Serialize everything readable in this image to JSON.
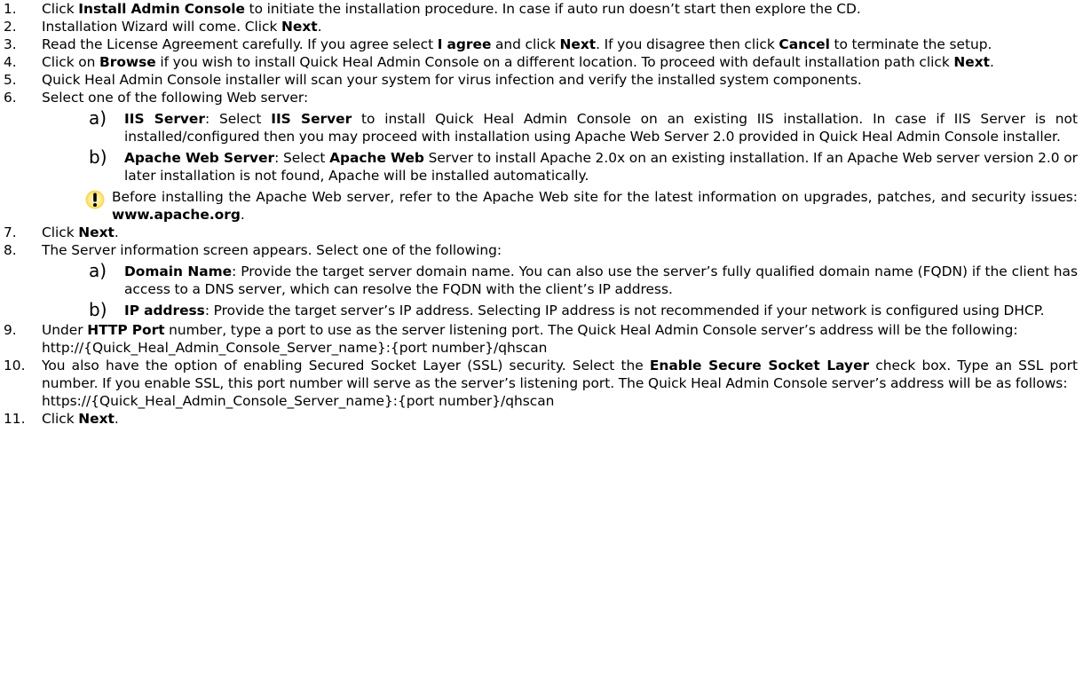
{
  "steps": [
    {
      "num": "1.",
      "parts": [
        {
          "t": "Click "
        },
        {
          "b": "Install Admin Console"
        },
        {
          "t": " to initiate the installation procedure. In case if auto run doesn’t start then explore the CD."
        }
      ]
    },
    {
      "num": "2.",
      "parts": [
        {
          "t": "Installation Wizard will come. Click "
        },
        {
          "b": "Next"
        },
        {
          "t": "."
        }
      ]
    },
    {
      "num": "3.",
      "parts": [
        {
          "t": "Read the License Agreement carefully. If you agree select "
        },
        {
          "b": "I agree"
        },
        {
          "t": " and click "
        },
        {
          "b": "Next"
        },
        {
          "t": ". If you disagree then click "
        },
        {
          "b": "Cancel"
        },
        {
          "t": " to terminate the setup."
        }
      ]
    },
    {
      "num": "4.",
      "parts": [
        {
          "t": "Click on "
        },
        {
          "b": "Browse"
        },
        {
          "t": " if you wish to install Quick Heal Admin Console on a different location. To proceed with default installation path click "
        },
        {
          "b": "Next"
        },
        {
          "t": "."
        }
      ]
    },
    {
      "num": "5.",
      "parts": [
        {
          "t": "Quick Heal Admin Console installer will scan your system for virus infection and verify the installed system components."
        }
      ]
    },
    {
      "num": "6.",
      "parts": [
        {
          "t": "Select one of the following Web server:"
        }
      ],
      "subs": [
        {
          "letter": "a)",
          "parts": [
            {
              "b": "IIS Server"
            },
            {
              "t": ": Select "
            },
            {
              "b": "IIS Server"
            },
            {
              "t": " to install Quick Heal Admin Console on an existing IIS installation. In case if IIS Server is not installed/configured then you may proceed with installation using Apache Web Server 2.0 provided in Quick Heal Admin Console installer."
            }
          ]
        },
        {
          "letter": "b)",
          "parts": [
            {
              "b": "Apache Web Server"
            },
            {
              "t": ": Select "
            },
            {
              "b": "Apache Web"
            },
            {
              "t": " Server to install Apache 2.0x on an existing installation. If an Apache Web server version 2.0 or later installation is not found, Apache will be installed automatically."
            }
          ]
        }
      ],
      "note": {
        "icon": "warning-exclamation-icon",
        "parts": [
          {
            "t": "Before installing the Apache Web server, refer to the Apache Web site for the latest information on upgrades, patches, and security issues: "
          },
          {
            "b": "www.apache.org"
          },
          {
            "t": "."
          }
        ]
      }
    },
    {
      "num": "7.",
      "parts": [
        {
          "t": "Click "
        },
        {
          "b": "Next"
        },
        {
          "t": "."
        }
      ]
    },
    {
      "num": "8.",
      "parts": [
        {
          "t": "The Server information screen appears. Select one of the following:"
        }
      ],
      "subs": [
        {
          "letter": "a)",
          "parts": [
            {
              "b": "Domain Name"
            },
            {
              "t": ": Provide the target server domain name. You can also use the server’s fully qualified domain name (FQDN) if the client has access to a DNS server, which can resolve the FQDN with the client’s IP address."
            }
          ]
        },
        {
          "letter": "b)",
          "parts": [
            {
              "b": "IP address"
            },
            {
              "t": ": Provide the target server’s IP address. Selecting IP address is not recommended if your network is configured using DHCP."
            }
          ]
        }
      ]
    },
    {
      "num": "9.",
      "parts": [
        {
          "t": "Under "
        },
        {
          "b": "HTTP Port"
        },
        {
          "t": " number, type a port to use as the server listening port. The Quick Heal Admin Console server’s address will be the following:"
        }
      ],
      "url": "http://{Quick_Heal_Admin_Console_Server_name}:{port number}/qhscan"
    },
    {
      "num": "10.",
      "parts": [
        {
          "t": "You also have the option of enabling Secured Socket Layer (SSL) security. Select the "
        },
        {
          "b": "Enable Secure Socket Layer"
        },
        {
          "t": " check box. Type an SSL port number. If you enable SSL, this port number will serve as the server’s listening port. The Quick Heal Admin Console server’s address will be as follows:"
        }
      ],
      "url": "https://{Quick_Heal_Admin_Console_Server_name}:{port number}/qhscan"
    },
    {
      "num": "11.",
      "parts": [
        {
          "t": "Click "
        },
        {
          "b": "Next"
        },
        {
          "t": "."
        }
      ]
    }
  ]
}
